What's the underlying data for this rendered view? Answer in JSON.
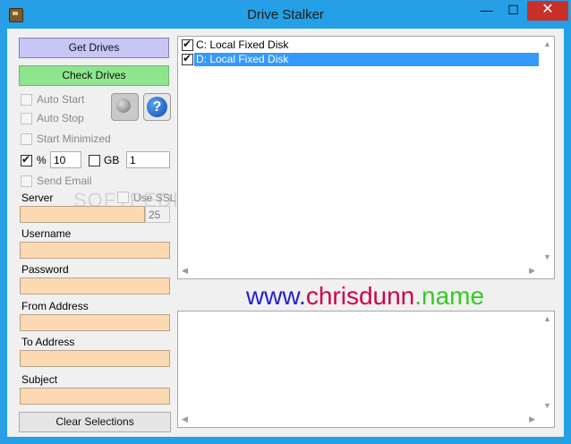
{
  "window": {
    "title": "Drive Stalker",
    "min_symbol": "—",
    "max_symbol": "☐",
    "close_symbol": "✕"
  },
  "left": {
    "get_drives": "Get Drives",
    "check_drives": "Check Drives",
    "auto_start": "Auto Start",
    "auto_stop": "Auto Stop",
    "start_minimized": "Start Minimized",
    "percent_label": "%",
    "percent_value": "10",
    "gb_label": "GB",
    "gb_value": "1",
    "send_email": "Send Email",
    "use_ssl": "Use SSL",
    "server_label": "Server",
    "server_value": "",
    "port_value": "25",
    "username_label": "Username",
    "username_value": "",
    "password_label": "Password",
    "password_value": "",
    "from_label": "From Address",
    "from_value": "",
    "to_label": "To Address",
    "to_value": "",
    "subject_label": "Subject",
    "subject_value": "",
    "clear": "Clear Selections",
    "help_symbol": "?"
  },
  "drives": [
    {
      "label": "C: Local Fixed Disk",
      "checked": true,
      "selected": false
    },
    {
      "label": "D: Local Fixed Disk",
      "checked": true,
      "selected": true
    }
  ],
  "website": {
    "part1": "www.",
    "part2": "chrisdunn",
    "part3": ".name",
    "color1": "#2222cc",
    "color2": "#d0004a",
    "color3": "#33cc22"
  },
  "watermark": "SOFTPEDIA",
  "scroll": {
    "up": "▲",
    "down": "▼",
    "left": "◀",
    "right": "▶"
  },
  "icons": [
    "app-icon",
    "globe-icon",
    "help-icon",
    "checkbox-icon"
  ]
}
